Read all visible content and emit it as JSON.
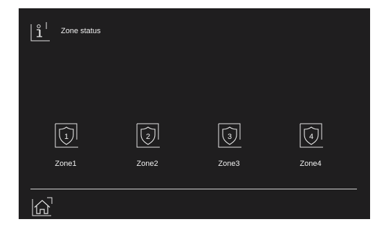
{
  "header": {
    "title": "Zone status",
    "icon": "info-icon"
  },
  "zones": [
    {
      "number": "1",
      "label": "Zone1",
      "icon": "shield-icon"
    },
    {
      "number": "2",
      "label": "Zone2",
      "icon": "shield-icon"
    },
    {
      "number": "3",
      "label": "Zone3",
      "icon": "shield-icon"
    },
    {
      "number": "4",
      "label": "Zone4",
      "icon": "shield-icon"
    }
  ],
  "footer": {
    "home_icon": "home-icon"
  },
  "colors": {
    "background": "#1f1e1f",
    "foreground": "#f2f2f2"
  }
}
